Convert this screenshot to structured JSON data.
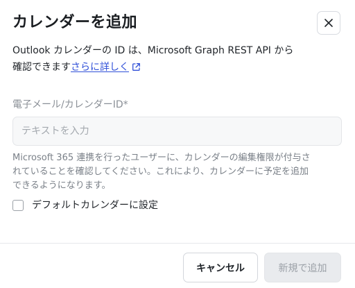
{
  "dialog": {
    "title": "カレンダーを追加",
    "close_label": "close"
  },
  "description": {
    "line1": "Outlook カレンダーの ID は、Microsoft Graph REST API から",
    "line2_prefix": "確認できます",
    "link_text": "さらに詳しく"
  },
  "field": {
    "label": "電子メール/カレンダーID*",
    "value": "",
    "placeholder": "テキストを入力"
  },
  "helper": {
    "line1": "Microsoft 365 連携を行ったユーザーに、カレンダーの編集権限が付与さ",
    "line2": "れていることを確認してください。これにより、カレンダーに予定を追加",
    "line3": "できるようになります。"
  },
  "checkbox": {
    "label": "デフォルトカレンダーに設定",
    "checked": false
  },
  "footer": {
    "cancel_label": "キャンセル",
    "add_label": "新規で追加"
  },
  "colors": {
    "link": "#2f4fd8",
    "primary_disabled_bg": "#e9ebee",
    "primary_disabled_text": "#9ba0a7"
  },
  "icons": {
    "close": "close-icon",
    "external_link": "external-link-icon"
  }
}
